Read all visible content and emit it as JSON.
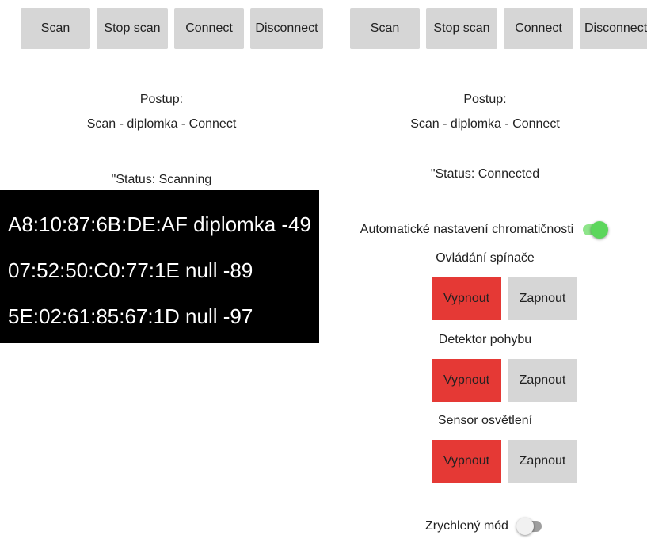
{
  "left_screen": {
    "buttons": {
      "scan": "Scan",
      "stop_scan": "Stop scan",
      "connect": "Connect",
      "disconnect": "Disconnect"
    },
    "instructions_title": "Postup:",
    "instructions_text": "Scan - diplomka - Connect",
    "status": "\"Status: Scanning",
    "devices": [
      "A8:10:87:6B:DE:AF diplomka -49",
      "07:52:50:C0:77:1E null -89",
      "5E:02:61:85:67:1D null -97"
    ]
  },
  "right_screen": {
    "buttons": {
      "scan": "Scan",
      "stop_scan": "Stop scan",
      "connect": "Connect",
      "disconnect": "Disconnect"
    },
    "instructions_title": "Postup:",
    "instructions_text": "Scan - diplomka - Connect",
    "status": "\"Status: Connected",
    "auto_chroma": {
      "label": "Automatické nastavení chromatičnosti",
      "on": true
    },
    "switch_control": {
      "label": "Ovládání spínače",
      "off_label": "Vypnout",
      "on_label": "Zapnout"
    },
    "motion_detector": {
      "label": "Detektor pohybu",
      "off_label": "Vypnout",
      "on_label": "Zapnout"
    },
    "light_sensor": {
      "label": "Sensor osvětlení",
      "off_label": "Vypnout",
      "on_label": "Zapnout"
    },
    "fast_mode": {
      "label": "Zrychlený mód",
      "on": false
    }
  },
  "colors": {
    "button_gray": "#d6d6d6",
    "button_red": "#e53935",
    "switch_on_track": "#8ee58a",
    "switch_on_thumb": "#5cd65c",
    "switch_off_track": "#9e9e9e",
    "switch_off_thumb": "#f1f1f1"
  }
}
